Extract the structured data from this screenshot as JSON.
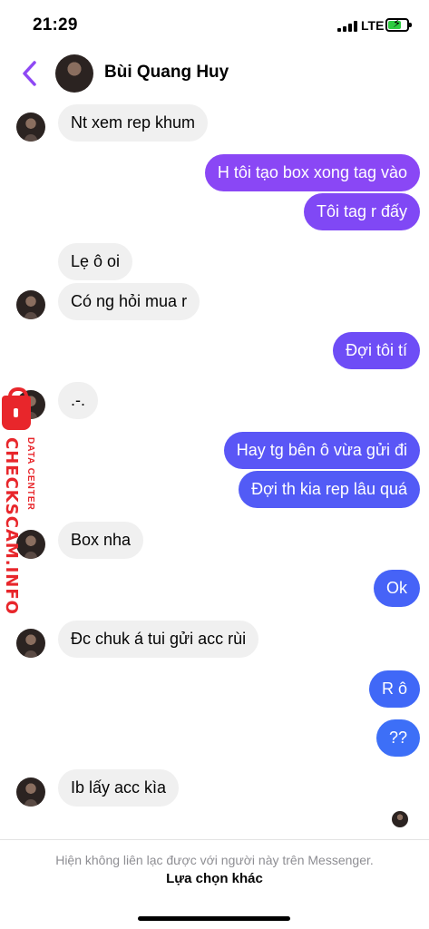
{
  "status_bar": {
    "time": "21:29",
    "network": "LTE"
  },
  "header": {
    "contact_name": "Bùi Quang Huy"
  },
  "colors": {
    "accent": "#8e48f4",
    "outgoing_top": "#8a47f5",
    "outgoing_bottom": "#3d6ff7",
    "incoming": "#f0f0f0",
    "watermark": "#e8262b"
  },
  "messages": [
    {
      "text": "Nt xem rep khum",
      "sender": "them"
    },
    {
      "text": "H tôi tạo box xong tag vào",
      "sender": "me"
    },
    {
      "text": "Tôi tag r đấy",
      "sender": "me"
    },
    {
      "text": "Lẹ ô oi",
      "sender": "them"
    },
    {
      "text": "Có ng hỏi mua r",
      "sender": "them"
    },
    {
      "text": "Đợi tôi tí",
      "sender": "me"
    },
    {
      "text": ".-.",
      "sender": "them"
    },
    {
      "text": "Hay tg bên ô vừa gửi đi",
      "sender": "me"
    },
    {
      "text": "Đợi th kia rep lâu quá",
      "sender": "me"
    },
    {
      "text": "Box nha",
      "sender": "them"
    },
    {
      "text": "Ok",
      "sender": "me"
    },
    {
      "text": "Đc chuk á tui gửi acc rùi",
      "sender": "them"
    },
    {
      "text": "R ô",
      "sender": "me"
    },
    {
      "text": "??",
      "sender": "me"
    },
    {
      "text": "Ib lấy acc kìa",
      "sender": "them"
    }
  ],
  "watermark": {
    "main": "CHECKSCAM.INFO",
    "sub": "DATA CENTER"
  },
  "footer": {
    "note": "Hiện không liên lạc được với người này trên Messenger.",
    "action": "Lựa chọn khác"
  }
}
